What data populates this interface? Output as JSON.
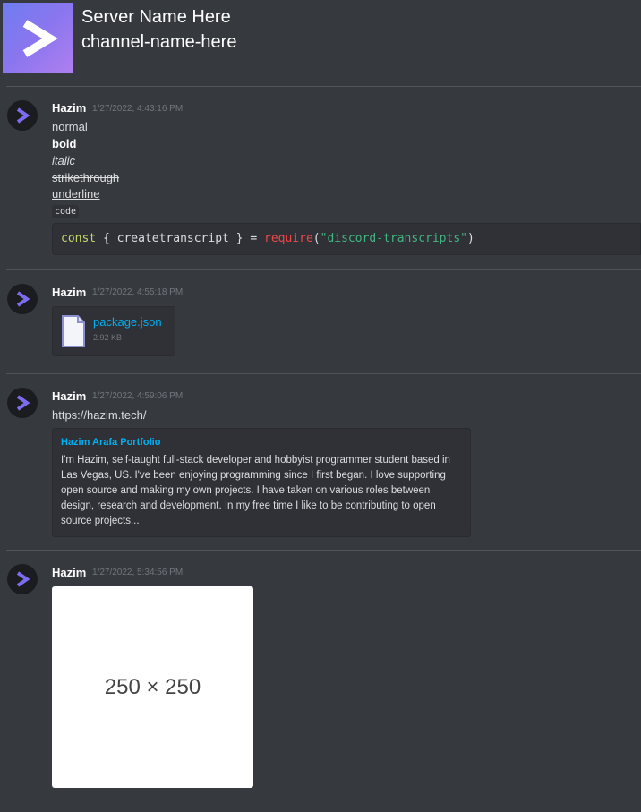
{
  "header": {
    "server_name": "Server Name Here",
    "channel_name": "channel-name-here",
    "icon": "chevron-right-icon"
  },
  "messages": [
    {
      "author": "Hazim",
      "timestamp": "1/27/2022, 4:43:16 PM",
      "lines": {
        "normal": "normal",
        "bold": "bold",
        "italic": "italic",
        "strikethrough": "strikethrough",
        "underline": "underline",
        "code": "code"
      },
      "codeblock": {
        "keyword": "const",
        "open": " { ",
        "name": "createtranscript",
        "close": " } = ",
        "func": "require",
        "paren_open": "(",
        "string": "\"discord-transcripts\"",
        "paren_close": ")"
      }
    },
    {
      "author": "Hazim",
      "timestamp": "1/27/2022, 4:55:18 PM",
      "attachment": {
        "name": "package.json",
        "size": "2.92 KB",
        "icon": "file-icon"
      }
    },
    {
      "author": "Hazim",
      "timestamp": "1/27/2022, 4:59:06 PM",
      "text": "https://hazim.tech/",
      "embed": {
        "title": "Hazim Arafa Portfolio",
        "description": "I'm Hazim, self-taught full-stack developer and hobbyist programmer student based in Las Vegas, US. I've been enjoying programming since I first began. I love supporting open source and making my own projects. I have taken on various roles between design, research and development. In my free time I like to be contributing to open source projects..."
      }
    },
    {
      "author": "Hazim",
      "timestamp": "1/27/2022, 5:34:56 PM",
      "image_text": "250 × 250"
    }
  ],
  "colors": {
    "background": "#36393e",
    "link": "#00b0f4",
    "accent": "#7b6cf0"
  }
}
